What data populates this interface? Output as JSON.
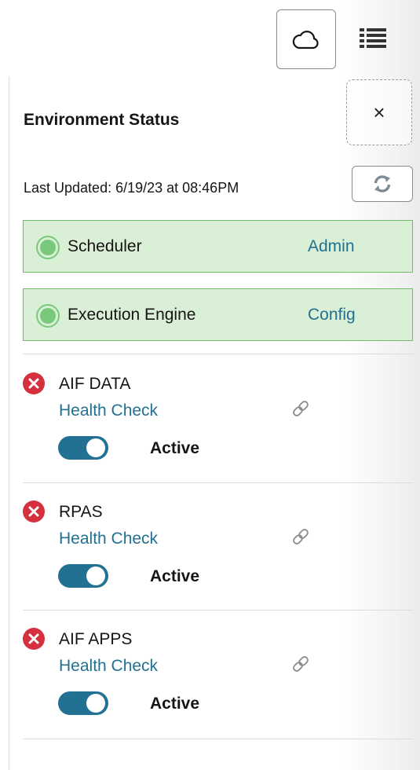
{
  "header": {
    "cloud_icon": "cloud-icon",
    "menu_icon": "list-menu-icon"
  },
  "panel": {
    "title": "Environment Status",
    "close_label": "×",
    "last_updated": "Last Updated: 6/19/23 at 08:46PM",
    "refresh_icon": "refresh-icon"
  },
  "services": [
    {
      "name": "Scheduler",
      "link": "Admin",
      "status": "up"
    },
    {
      "name": "Execution Engine",
      "link": "Config",
      "status": "up"
    }
  ],
  "environments": [
    {
      "name": "AIF DATA",
      "health_check": "Health Check",
      "toggle_on": true,
      "state": "Active"
    },
    {
      "name": "RPAS",
      "health_check": "Health Check",
      "toggle_on": true,
      "state": "Active"
    },
    {
      "name": "AIF APPS",
      "health_check": "Health Check",
      "toggle_on": true,
      "state": "Active"
    }
  ],
  "colors": {
    "accent": "#227092",
    "ok_bg": "#d9f0d6",
    "ok_border": "#71bb6a",
    "ok_dot": "#78c97b",
    "error": "#d5303e"
  }
}
